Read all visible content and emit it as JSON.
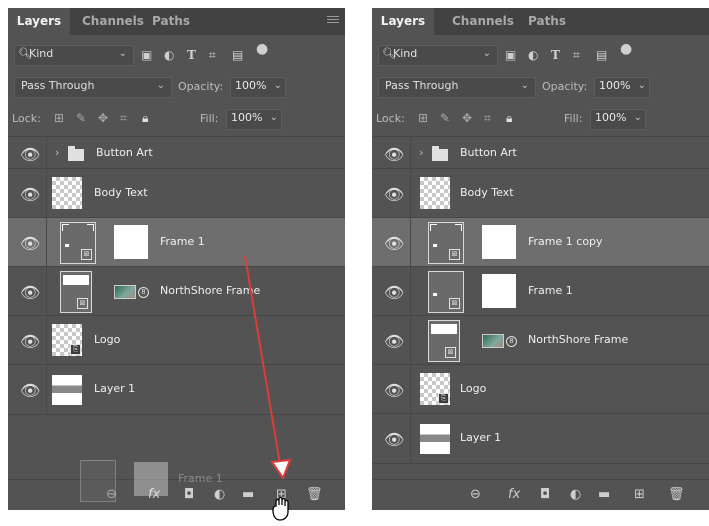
{
  "tabs": [
    "Layers",
    "Channels",
    "Paths"
  ],
  "filter": {
    "kind_label": "Kind"
  },
  "blend": {
    "mode": "Pass Through",
    "opacity_label": "Opacity:",
    "opacity_value": "100%"
  },
  "lock": {
    "label": "Lock:",
    "fill_label": "Fill:",
    "fill_value": "100%"
  },
  "left_panel": {
    "layers": [
      {
        "name": "Button Art"
      },
      {
        "name": "Body Text"
      },
      {
        "name": "Frame 1"
      },
      {
        "name": "NorthShore Frame"
      },
      {
        "name": "Logo"
      },
      {
        "name": "Layer 1"
      }
    ],
    "drag_ghost_label": "Frame 1"
  },
  "right_panel": {
    "layers": [
      {
        "name": "Button Art"
      },
      {
        "name": "Body Text"
      },
      {
        "name": "Frame 1 copy"
      },
      {
        "name": "Frame 1"
      },
      {
        "name": "NorthShore Frame"
      },
      {
        "name": "Logo"
      },
      {
        "name": "Layer 1"
      }
    ]
  },
  "colors": {
    "panel": "#535353",
    "tab_bar": "#424242",
    "selected_row": "#6e6e6e",
    "arrow": "#e03a3a"
  }
}
